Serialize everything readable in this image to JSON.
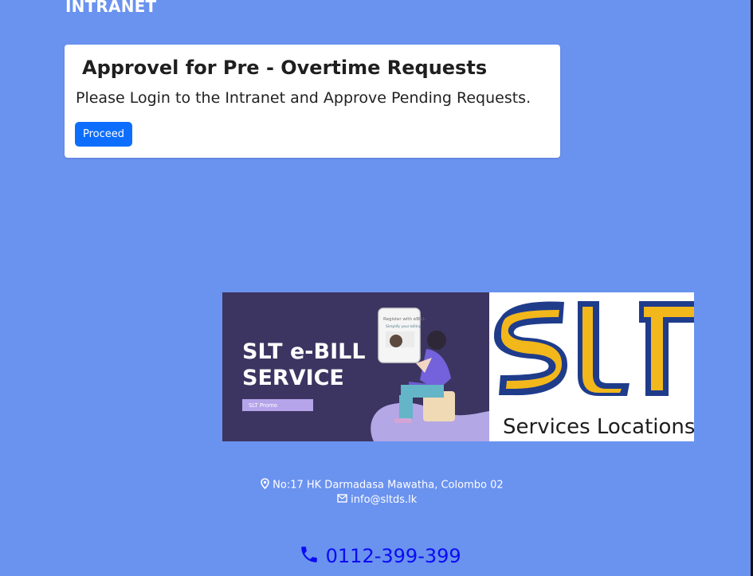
{
  "header": {
    "brand": "INTRANET"
  },
  "card": {
    "title": "Approvel for Pre - Overtime Requests",
    "message": "Please Login to the Intranet and Approve Pending Requests.",
    "proceed_label": "Proceed"
  },
  "banner": {
    "ebill": {
      "line1": "SLT e-BILL",
      "line2": "SERVICE",
      "tag": "SLT Promo",
      "screen_line1": "Register with eBILL",
      "screen_line2": "Simplify your billing"
    },
    "logo": {
      "mark": "SLT",
      "caption": "Services Locations T"
    }
  },
  "footer": {
    "address": "No:17 HK Darmadasa Mawatha, Colombo 02",
    "email": "info@sltds.lk",
    "phone": "0112-399-399"
  },
  "colors": {
    "background": "#6a92ef",
    "button": "#0d6efd",
    "phone": "#0b0bf4",
    "ebill_panel": "#3c3561",
    "logo_yellow": "#f2b71b"
  },
  "icons": {
    "location": "location-pin-icon",
    "email": "envelope-icon",
    "phone": "phone-icon"
  }
}
